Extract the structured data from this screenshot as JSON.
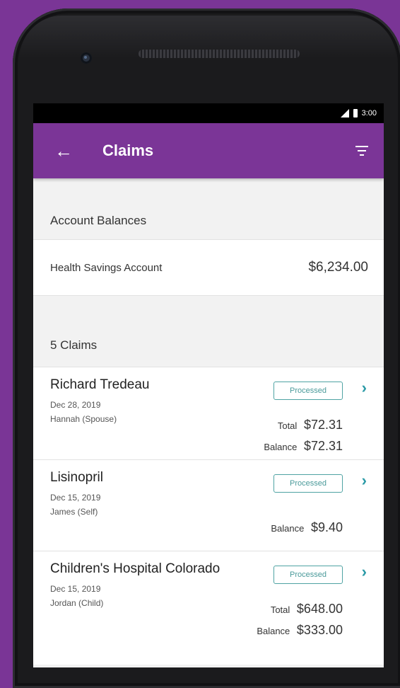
{
  "status": {
    "time": "3:00"
  },
  "appbar": {
    "back_icon": "arrow-left-icon",
    "title": "Claims",
    "filter_icon": "filter-icon"
  },
  "accounts": {
    "header": "Account Balances",
    "rows": [
      {
        "label": "Health Savings Account",
        "amount": "$6,234.00"
      }
    ]
  },
  "claims": {
    "header": "5 Claims",
    "items": [
      {
        "name": "Richard Tredeau",
        "date": "Dec 28, 2019",
        "member": "Hannah (Spouse)",
        "status": "Processed",
        "total_label": "Total",
        "total": "$72.31",
        "balance_label": "Balance",
        "balance": "$72.31"
      },
      {
        "name": "Lisinopril",
        "date": "Dec 15, 2019",
        "member": "James (Self)",
        "status": "Processed",
        "balance_label": "Balance",
        "balance": "$9.40"
      },
      {
        "name": "Children's Hospital Colorado",
        "date": "Dec 15, 2019",
        "member": "Jordan (Child)",
        "status": "Processed",
        "total_label": "Total",
        "total": "$648.00",
        "balance_label": "Balance",
        "balance": "$333.00"
      }
    ]
  },
  "colors": {
    "brand": "#7b3597",
    "background": "#7a3596",
    "accent": "#2a9aa6"
  }
}
